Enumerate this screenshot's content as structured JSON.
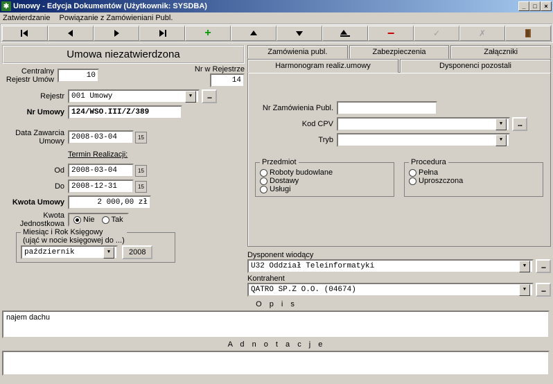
{
  "window": {
    "title": "Umowy - Edycja Dokumentów (Użytkownik: SYSDBA)"
  },
  "menu": {
    "m1": "Zatwierdzanie",
    "m2": "Powiązanie z Zamówieniani Publ."
  },
  "toolbar": {
    "first": "|◄",
    "prev": "◄",
    "next": "►",
    "last": "►|",
    "add": "+",
    "up": "▲",
    "down": "▼",
    "minus": "−",
    "check": "✓",
    "x": "✗",
    "exit": "🚪"
  },
  "header": {
    "title": "Umowa niezatwierdzona"
  },
  "left": {
    "central_lbl": "Centralny Rejestr Umów",
    "central_val": "10",
    "nrw_lbl": "Nr w Rejestrze",
    "nrw_val": "14",
    "rejestr_lbl": "Rejestr",
    "rejestr_val": "001  Umowy",
    "nrumowy_lbl": "Nr Umowy",
    "nrumowy_val": "124/WSO.III/Z/389",
    "datazaw_lbl": "Data Zawarcia Umowy",
    "datazaw_val": "2008-03-04",
    "termin_lbl": "Termin Realizacji:",
    "od_lbl": "Od",
    "od_val": "2008-03-04",
    "do_lbl": "Do",
    "do_val": "2008-12-31",
    "kwota_lbl": "Kwota Umowy",
    "kwota_val": "2 000,00 zł",
    "kwotaj_lbl": "Kwota Jednostkowa",
    "nie": "Nie",
    "tak": "Tak",
    "miesiac_legend": "Miesiąc i Rok Księgowy",
    "miesiac_sub": "(ująć w nocie księgowej do ...)",
    "miesiac_val": "październik",
    "rok_val": "2008"
  },
  "right": {
    "tabs": {
      "t1": "Zamówienia publ.",
      "t2": "Zabezpieczenia",
      "t3": "Załączniki",
      "t4": "Harmonogram realiz.umowy",
      "t5": "Dysponenci pozostali"
    },
    "nrzam_lbl": "Nr Zamówienia Publ.",
    "kodcpv_lbl": "Kod CPV",
    "tryb_lbl": "Tryb",
    "przedmiot": {
      "legend": "Przedmiot",
      "o1": "Roboty budowlane",
      "o2": "Dostawy",
      "o3": "Usługi"
    },
    "procedura": {
      "legend": "Procedura",
      "o1": "Pełna",
      "o2": "Uproszczona"
    },
    "dysp_lbl": "Dysponent wiodący",
    "dysp_val": "U32  Oddział Teleinformatyki",
    "kontr_lbl": "Kontrahent",
    "kontr_val": "QATRO  SP.Z O.O. (04674)"
  },
  "bottom": {
    "opis_lbl": "O p i s",
    "opis_val": "najem dachu",
    "adn_lbl": "A d n o t a c j e",
    "adn_val": ""
  },
  "icons": {
    "ellipsis": "...",
    "cal": "15",
    "dropdown": "▼"
  }
}
